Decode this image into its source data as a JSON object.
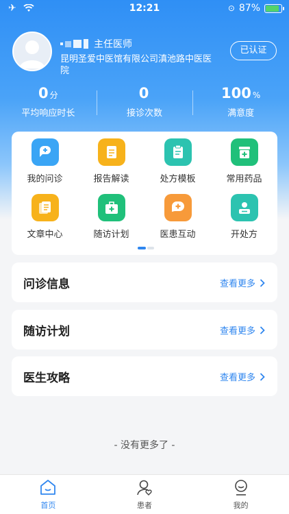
{
  "status_bar": {
    "time": "12:21",
    "battery": "87%",
    "battery_level": 0.87
  },
  "profile": {
    "title": "主任医师",
    "hospital": "昆明圣爱中医馆有限公司滇池路中医医院",
    "verified_label": "已认证"
  },
  "stats": [
    {
      "value": "0",
      "unit": "分",
      "label": "平均响应时长"
    },
    {
      "value": "0",
      "unit": "",
      "label": "接诊次数"
    },
    {
      "value": "100",
      "unit": "%",
      "label": "满意度"
    }
  ],
  "features": [
    {
      "label": "我的问诊",
      "icon": "chat-plus-icon",
      "color": "#3aa5f5"
    },
    {
      "label": "报告解读",
      "icon": "report-icon",
      "color": "#f7b21b"
    },
    {
      "label": "处方模板",
      "icon": "clipboard-icon",
      "color": "#2cc3b0"
    },
    {
      "label": "常用药品",
      "icon": "medicine-box-icon",
      "color": "#20c07a"
    },
    {
      "label": "文章中心",
      "icon": "articles-icon",
      "color": "#f7b21b"
    },
    {
      "label": "随访计划",
      "icon": "medical-kit-icon",
      "color": "#20c07a"
    },
    {
      "label": "医患互动",
      "icon": "chat-cross-icon",
      "color": "#f79a3a"
    },
    {
      "label": "开处方",
      "icon": "prescription-icon",
      "color": "#2cc3b0"
    }
  ],
  "sections": [
    {
      "title": "问诊信息",
      "more": "查看更多"
    },
    {
      "title": "随访计划",
      "more": "查看更多"
    },
    {
      "title": "医生攻略",
      "more": "查看更多"
    }
  ],
  "footer_text": "- 没有更多了 -",
  "tabs": [
    {
      "label": "首页",
      "icon": "home-icon"
    },
    {
      "label": "患者",
      "icon": "patient-icon"
    },
    {
      "label": "我的",
      "icon": "profile-icon"
    }
  ],
  "colors": {
    "primary": "#2f86ef",
    "background": "#f4f5f7"
  }
}
